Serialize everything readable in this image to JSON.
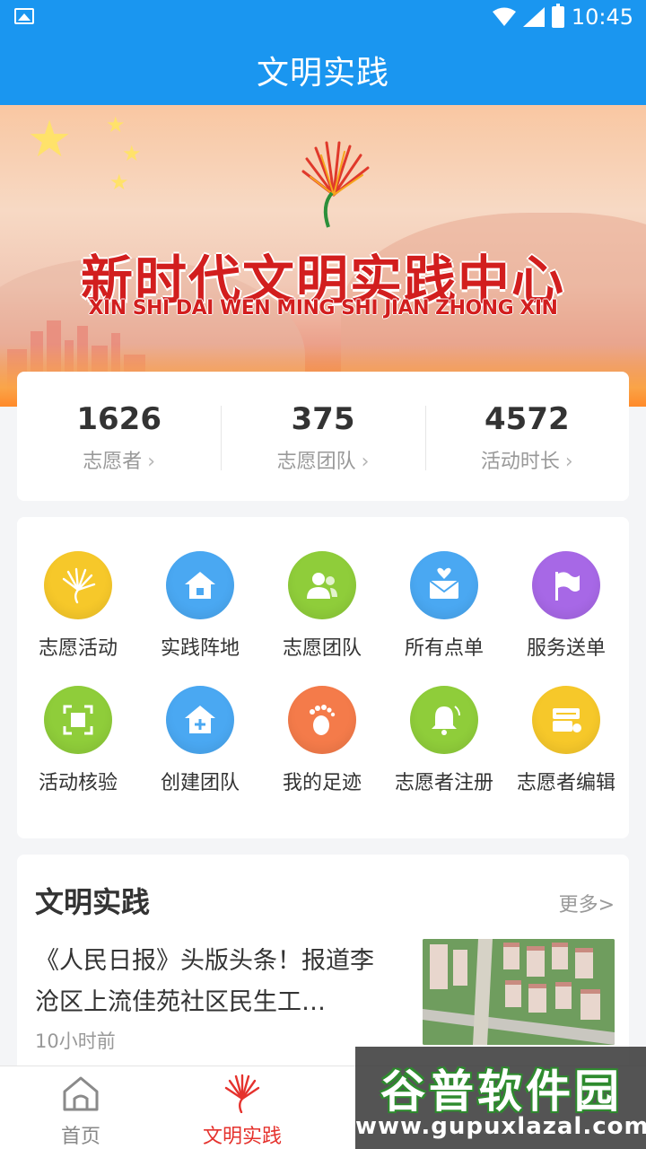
{
  "status_bar": {
    "time": "10:45"
  },
  "app_bar": {
    "title": "文明实践"
  },
  "banner": {
    "title_cn": "新时代文明实践中心",
    "title_en": "XIN SHI DAI WEN MING SHI JIAN ZHONG XIN"
  },
  "stats": [
    {
      "value": "1626",
      "label": "志愿者"
    },
    {
      "value": "375",
      "label": "志愿团队"
    },
    {
      "value": "4572",
      "label": "活动时长"
    }
  ],
  "grid": {
    "items": [
      {
        "label": "志愿活动",
        "icon": "fan-icon",
        "color": "#f6c82a"
      },
      {
        "label": "实践阵地",
        "icon": "home-icon",
        "color": "#4aa8f2"
      },
      {
        "label": "志愿团队",
        "icon": "team-icon",
        "color": "#8fcd3a"
      },
      {
        "label": "所有点单",
        "icon": "mail-heart-icon",
        "color": "#4aa8f2"
      },
      {
        "label": "服务送单",
        "icon": "flag-icon",
        "color": "#a768e6"
      },
      {
        "label": "活动核验",
        "icon": "scan-icon",
        "color": "#8fcd3a"
      },
      {
        "label": "创建团队",
        "icon": "home-plus-icon",
        "color": "#4aa8f2"
      },
      {
        "label": "我的足迹",
        "icon": "footprint-icon",
        "color": "#f47b4a"
      },
      {
        "label": "志愿者注册",
        "icon": "bell-icon",
        "color": "#8fcd3a"
      },
      {
        "label": "志愿者编辑",
        "icon": "edit-card-icon",
        "color": "#f6c82a"
      }
    ]
  },
  "news": {
    "section_title": "文明实践",
    "more": "更多>",
    "item": {
      "headline": "《人民日报》头版头条！报道李沧区上流佳苑社区民生工…",
      "time": "10小时前"
    }
  },
  "tab_bar": {
    "tabs": [
      {
        "label": "首页",
        "active": false
      },
      {
        "label": "文明实践",
        "active": true
      }
    ],
    "active_color": "#e5322d",
    "inactive_color": "#888888"
  },
  "watermark": {
    "title": "谷普软件园",
    "url": "www.gupuxlazal.com"
  }
}
